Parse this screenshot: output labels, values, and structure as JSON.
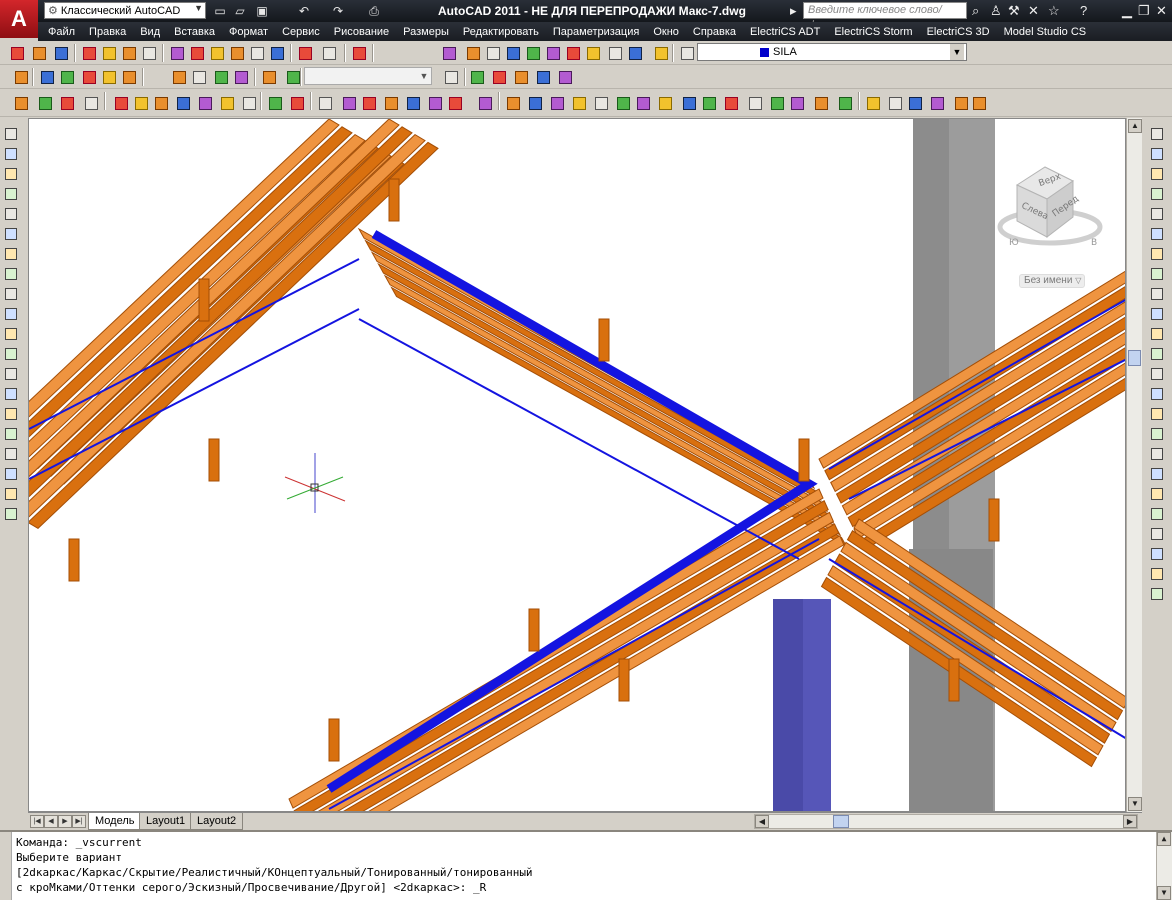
{
  "window": {
    "title": "AutoCAD 2011 - НЕ ДЛЯ ПЕРЕПРОДАЖИ   Макс-7.dwg",
    "workspace": "Классический AutoCAD",
    "search_placeholder": "Введите ключевое слово/фразу",
    "logo_letter": "A"
  },
  "menu": [
    "Файл",
    "Правка",
    "Вид",
    "Вставка",
    "Формат",
    "Сервис",
    "Рисование",
    "Размеры",
    "Редактировать",
    "Параметризация",
    "Окно",
    "Справка",
    "ElectriCS ADT",
    "ElectriCS Storm",
    "ElectriCS 3D",
    "Model Studio CS"
  ],
  "layer": {
    "name": "SILA",
    "color": "#0000cc"
  },
  "viewcube": {
    "top": "Верх",
    "left": "Слева",
    "front": "Перед",
    "compass_s": "Ю",
    "compass_e": "В"
  },
  "named_view": "Без имени",
  "layout_tabs": [
    "Модель",
    "Layout1",
    "Layout2"
  ],
  "active_tab": "Модель",
  "command_lines": [
    "Команда: _vscurrent",
    "Выберите вариант",
    "[2dкаркас/Каркас/Скрытие/Реалистичный/КОнцептуальный/Тонированный/тонированный",
    "с кроМками/Оттенки серого/Эскизный/Просвечивание/Другой] <2dкаркас>: _R"
  ],
  "colors": {
    "tray": "#d9700f",
    "tray_dark": "#a44e06",
    "tray_light": "#ef9440",
    "cable": "#1414e0",
    "column_grey": "#8c8c8c",
    "column_blue": "#4a4aa8",
    "title_bg": "#1b1e23"
  },
  "icons": {
    "quick_access": [
      "new-icon",
      "open-icon",
      "save-icon",
      "undo-icon",
      "redo-icon",
      "print-icon"
    ],
    "title_right": [
      "binoculars-icon",
      "person-icon",
      "wrench-icon",
      "x-tools-icon",
      "star-icon",
      "help-icon",
      "minimize-icon",
      "restore-icon",
      "close-icon"
    ]
  }
}
